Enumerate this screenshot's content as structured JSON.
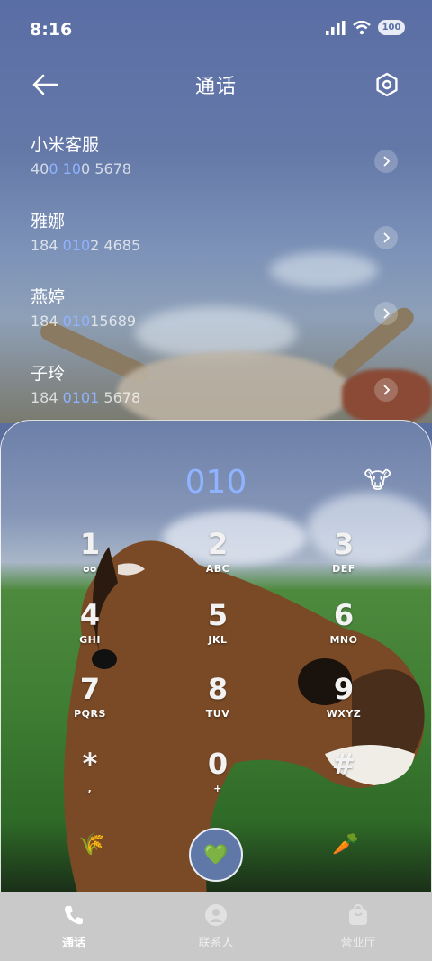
{
  "status_bar": {
    "time": "8:16",
    "battery": "100"
  },
  "header": {
    "title": "通话",
    "back_icon": "arrow-left-icon",
    "settings_icon": "hexagon-settings-icon"
  },
  "contacts": [
    {
      "name": "小米客服",
      "number_parts": [
        "40",
        "0",
        " ",
        "10",
        "0 5678"
      ]
    },
    {
      "name": "雅娜",
      "number_parts": [
        "184 ",
        "010",
        "2 4685"
      ]
    },
    {
      "name": "燕婷",
      "number_parts": [
        "184 ",
        "010",
        "15689"
      ]
    },
    {
      "name": "子玲",
      "number_parts": [
        "184 ",
        "0101",
        " 5678"
      ]
    }
  ],
  "dialer": {
    "entered_number": "010",
    "keys": [
      {
        "digit": "1",
        "letters": "ᴑᴑ"
      },
      {
        "digit": "2",
        "letters": "ABC"
      },
      {
        "digit": "3",
        "letters": "DEF"
      },
      {
        "digit": "4",
        "letters": "GHI"
      },
      {
        "digit": "5",
        "letters": "JKL"
      },
      {
        "digit": "6",
        "letters": "MNO"
      },
      {
        "digit": "7",
        "letters": "PQRS"
      },
      {
        "digit": "8",
        "letters": "TUV"
      },
      {
        "digit": "9",
        "letters": "WXYZ"
      },
      {
        "digit": "*",
        "letters": ","
      },
      {
        "digit": "0",
        "letters": "+"
      },
      {
        "digit": "#",
        "letters": ""
      }
    ],
    "call_icon": "💚",
    "left_icon": "🌾",
    "right_icon": "🥕",
    "corner_emoji": "🐮"
  },
  "tabs": [
    {
      "label": "通话",
      "icon": "phone-icon",
      "active": true
    },
    {
      "label": "联系人",
      "icon": "person-icon",
      "active": false
    },
    {
      "label": "营业厅",
      "icon": "bag-icon",
      "active": false
    }
  ],
  "colors": {
    "accent": "#8fb3ff",
    "sky": "#5a6ea6"
  }
}
